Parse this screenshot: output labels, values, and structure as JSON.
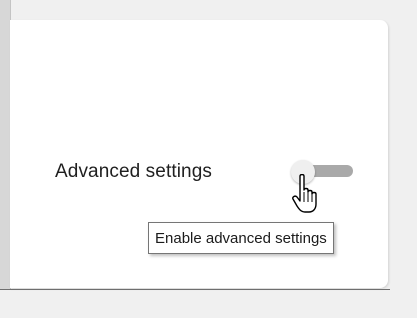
{
  "settings": {
    "advanced_label": "Advanced settings",
    "advanced_toggle_state": "off",
    "tooltip_text": "Enable advanced settings"
  },
  "colors": {
    "track": "#a9a9a9",
    "thumb": "#efefef",
    "panel": "#ffffff"
  },
  "icons": {
    "cursor": "hand-pointer-icon"
  }
}
